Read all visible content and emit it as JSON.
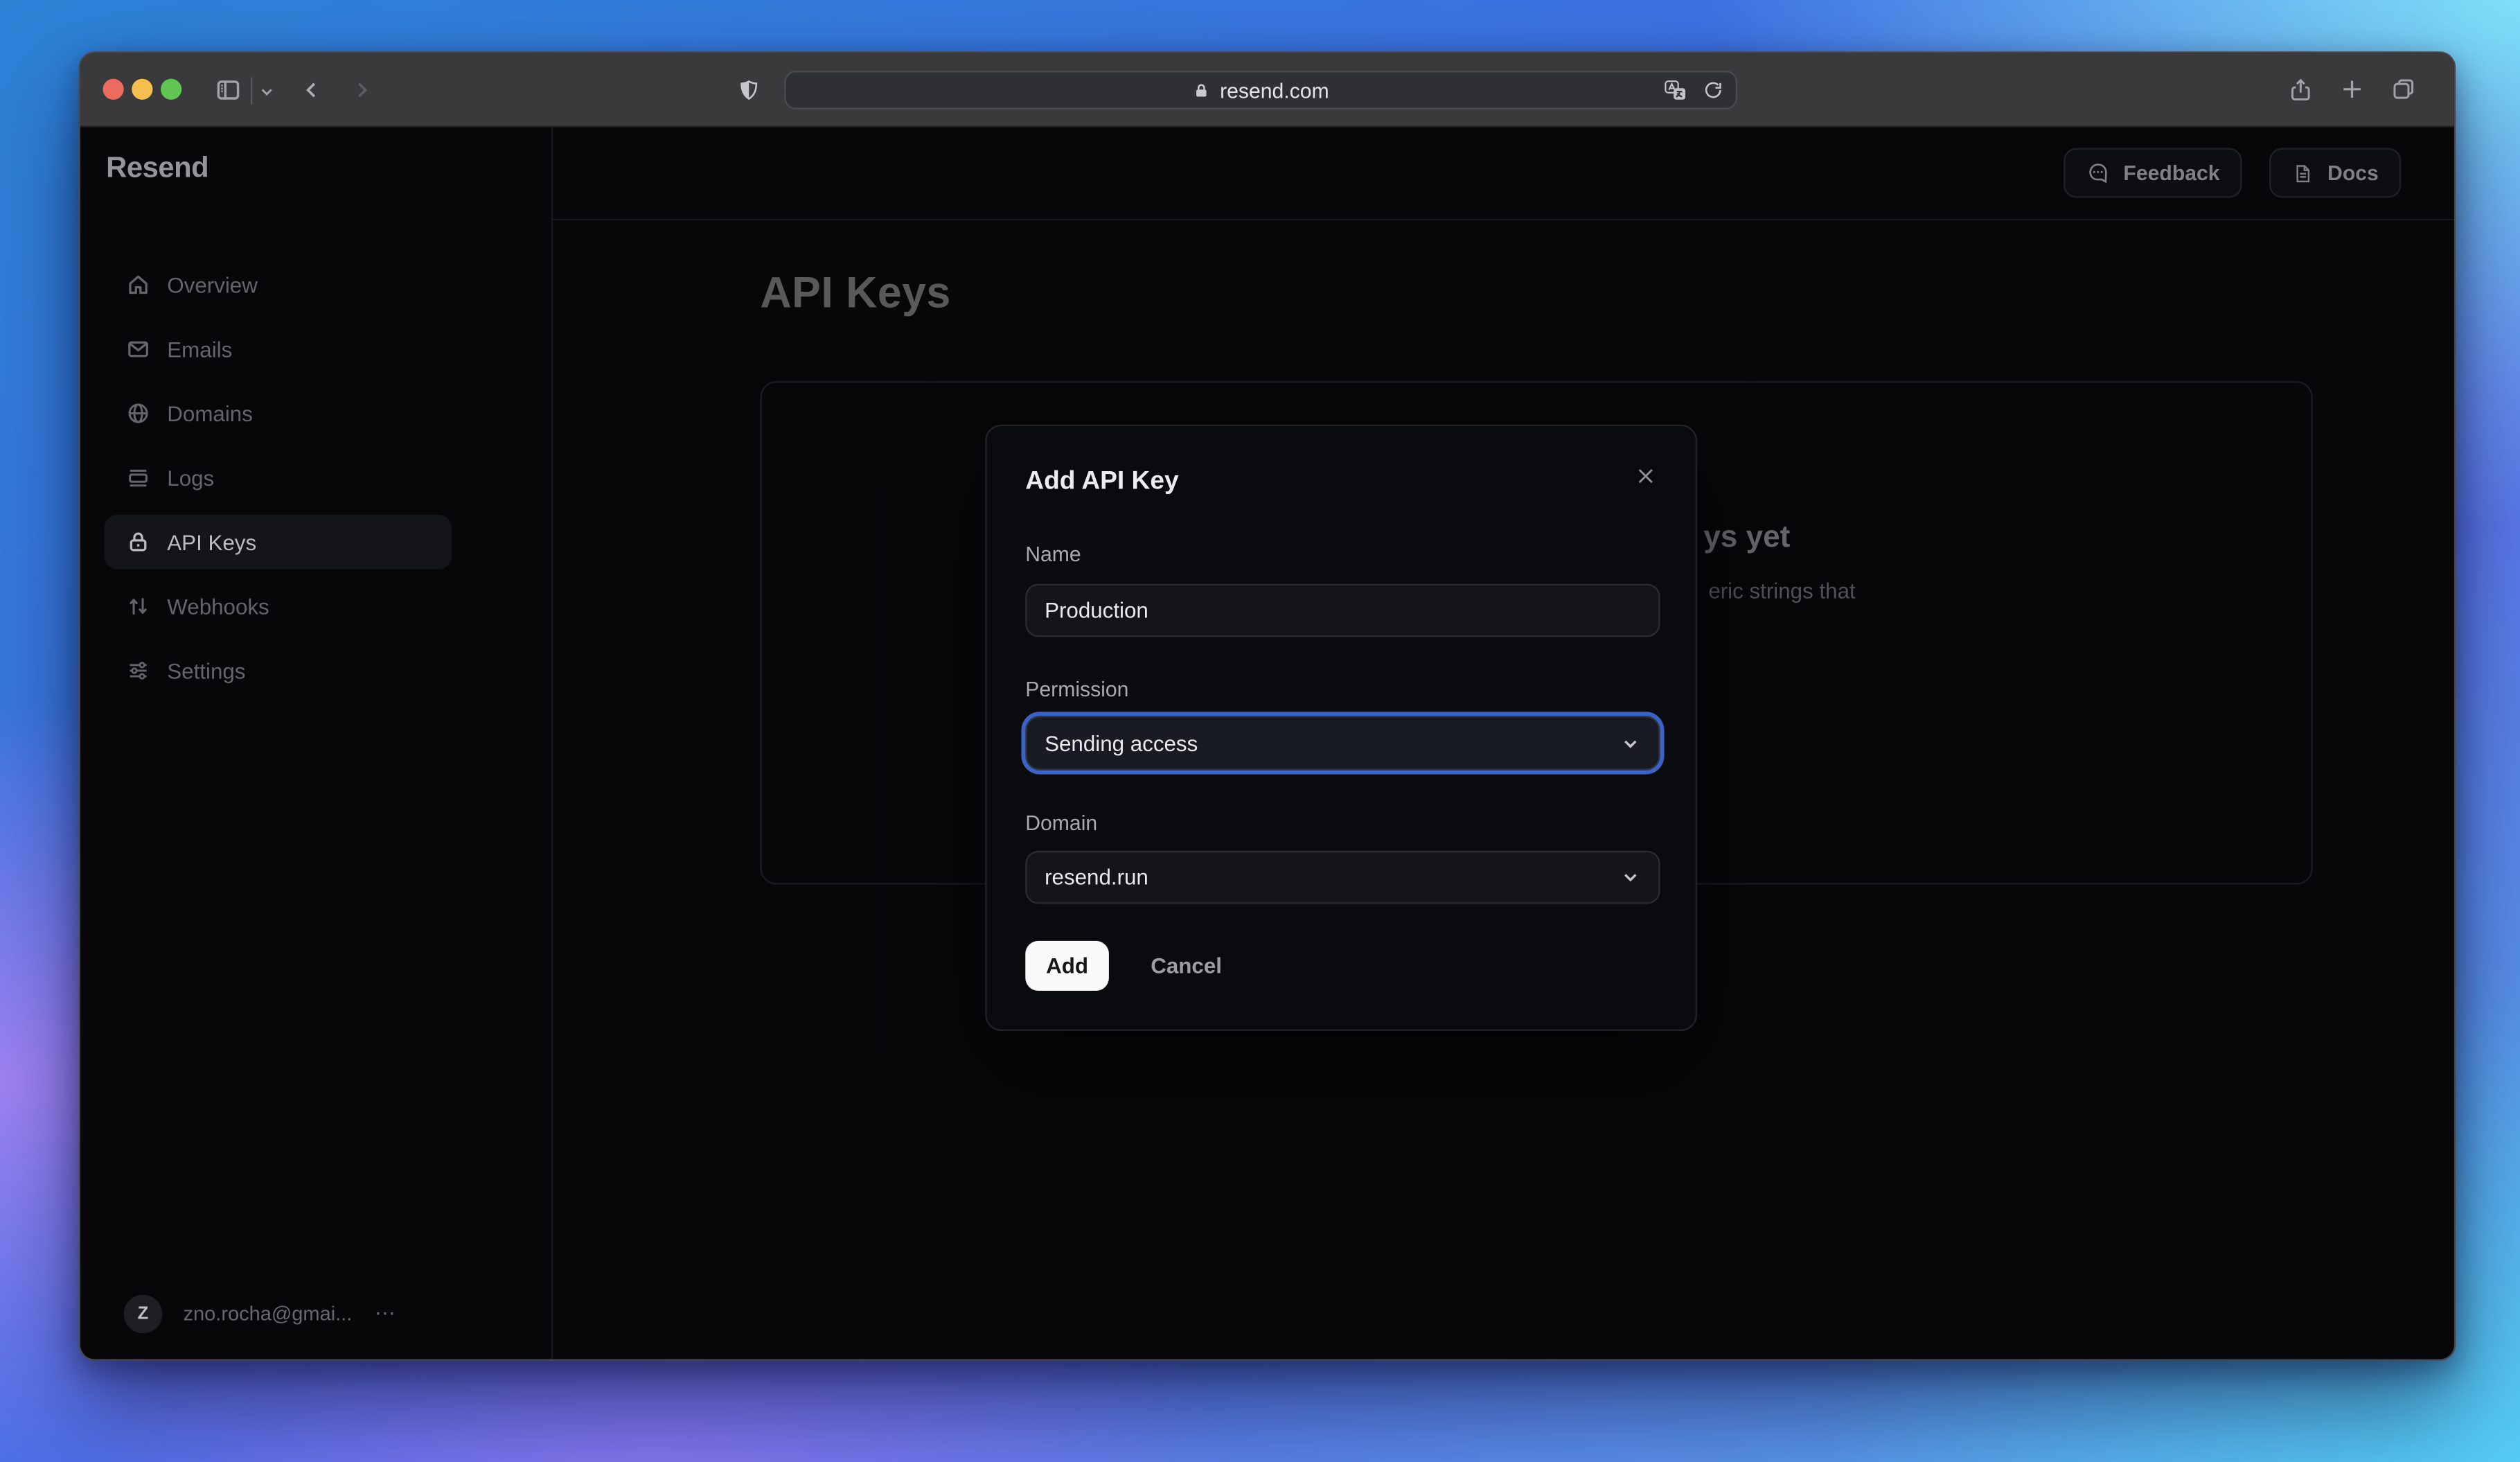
{
  "browser": {
    "url": "resend.com",
    "traffic_lights": {
      "red": "#ec6a5e",
      "yellow": "#f5bf4f",
      "green": "#61c554"
    }
  },
  "sidebar": {
    "logo": "Resend",
    "items": [
      {
        "label": "Overview",
        "icon": "home-icon",
        "active": false
      },
      {
        "label": "Emails",
        "icon": "mail-icon",
        "active": false
      },
      {
        "label": "Domains",
        "icon": "globe-icon",
        "active": false
      },
      {
        "label": "Logs",
        "icon": "logs-icon",
        "active": false
      },
      {
        "label": "API Keys",
        "icon": "lock-icon",
        "active": true
      },
      {
        "label": "Webhooks",
        "icon": "webhooks-icon",
        "active": false
      },
      {
        "label": "Settings",
        "icon": "sliders-icon",
        "active": false
      }
    ],
    "user": {
      "initial": "Z",
      "email": "zno.rocha@gmai...",
      "menu": "⋯"
    }
  },
  "header": {
    "feedback": "Feedback",
    "docs": "Docs"
  },
  "page": {
    "title": "API Keys",
    "empty_heading_fragment": "ys yet",
    "empty_body_fragment": "eric strings that"
  },
  "modal": {
    "title": "Add API Key",
    "close": "✕",
    "name_label": "Name",
    "name_value": "Production",
    "permission_label": "Permission",
    "permission_value": "Sending access",
    "domain_label": "Domain",
    "domain_value": "resend.run",
    "add": "Add",
    "cancel": "Cancel"
  },
  "colors": {
    "focus_ring": "#3b63c7",
    "accent_button": "#fafafa"
  }
}
